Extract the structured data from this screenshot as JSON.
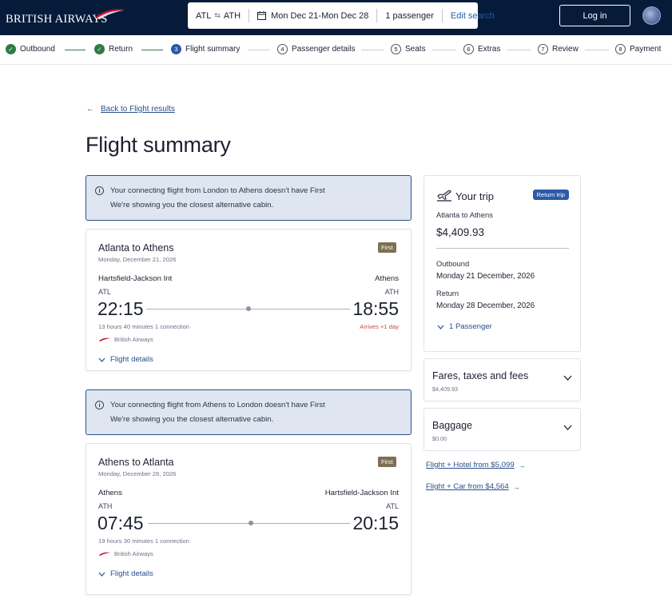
{
  "header": {
    "logo_text": "BRITISH AIRWAYS",
    "search": {
      "origin": "ATL",
      "destination": "ATH",
      "dates": "Mon Dec 21-Mon Dec 28",
      "passengers": "1 passenger",
      "edit_label": "Edit search"
    },
    "login_label": "Log in"
  },
  "steps": [
    {
      "label": "Outbound",
      "state": "done"
    },
    {
      "label": "Return",
      "state": "done"
    },
    {
      "label": "Flight summary",
      "state": "current",
      "number": "3"
    },
    {
      "label": "Passenger details",
      "state": "todo",
      "number": "4"
    },
    {
      "label": "Seats",
      "state": "todo",
      "number": "5"
    },
    {
      "label": "Extras",
      "state": "todo",
      "number": "6"
    },
    {
      "label": "Review",
      "state": "todo",
      "number": "7"
    },
    {
      "label": "Payment",
      "state": "todo",
      "number": "8"
    }
  ],
  "back_link": "Back to Flight results",
  "page_title": "Flight summary",
  "notices": [
    {
      "line1": "Your connecting flight from London to Athens doesn't have First",
      "line2": "We're showing you the closest alternative cabin."
    },
    {
      "line1": "Your connecting flight from Athens to London doesn't have First",
      "line2": "We're showing you the closest alternative cabin."
    }
  ],
  "flights": [
    {
      "route": "Atlanta to Athens",
      "date": "Monday, December 21, 2026",
      "cabin": "First",
      "from_name": "Hartsfield-Jackson Int",
      "from_code": "ATL",
      "to_name": "Athens",
      "to_code": "ATH",
      "depart": "22:15",
      "arrive": "18:55",
      "duration": "13 hours 40 minutes  1 connection",
      "arrives_note": "Arrives +1 day",
      "airline": "British Airways",
      "details_label": "Flight details"
    },
    {
      "route": "Athens to Atlanta",
      "date": "Monday, December 28, 2026",
      "cabin": "First",
      "from_name": "Athens",
      "from_code": "ATH",
      "to_name": "Hartsfield-Jackson Int",
      "to_code": "ATL",
      "depart": "07:45",
      "arrive": "20:15",
      "duration": "19 hours 30 minutes  1 connection",
      "arrives_note": "",
      "airline": "British Airways",
      "details_label": "Flight details"
    }
  ],
  "trip": {
    "title": "Your trip",
    "badge": "Return trip",
    "route": "Atlanta to Athens",
    "price": "$4,409.93",
    "outbound_label": "Outbound",
    "outbound_date": "Monday 21 December, 2026",
    "return_label": "Return",
    "return_date": "Monday 28 December, 2026",
    "passengers": "1 Passenger"
  },
  "fares": {
    "title": "Fares, taxes and fees",
    "amount": "$4,409.93"
  },
  "baggage": {
    "title": "Baggage",
    "amount": "$0.00"
  },
  "upsells": [
    {
      "label": "Flight + Hotel from $5,099"
    },
    {
      "label": "Flight + Car from $4,564"
    }
  ],
  "colors": {
    "navy": "#061b3a",
    "link": "#2a4f8c",
    "done": "#2f7a46",
    "current": "#2a5aa8",
    "first_badge": "#7d7053",
    "arrives": "#c44a4a"
  }
}
